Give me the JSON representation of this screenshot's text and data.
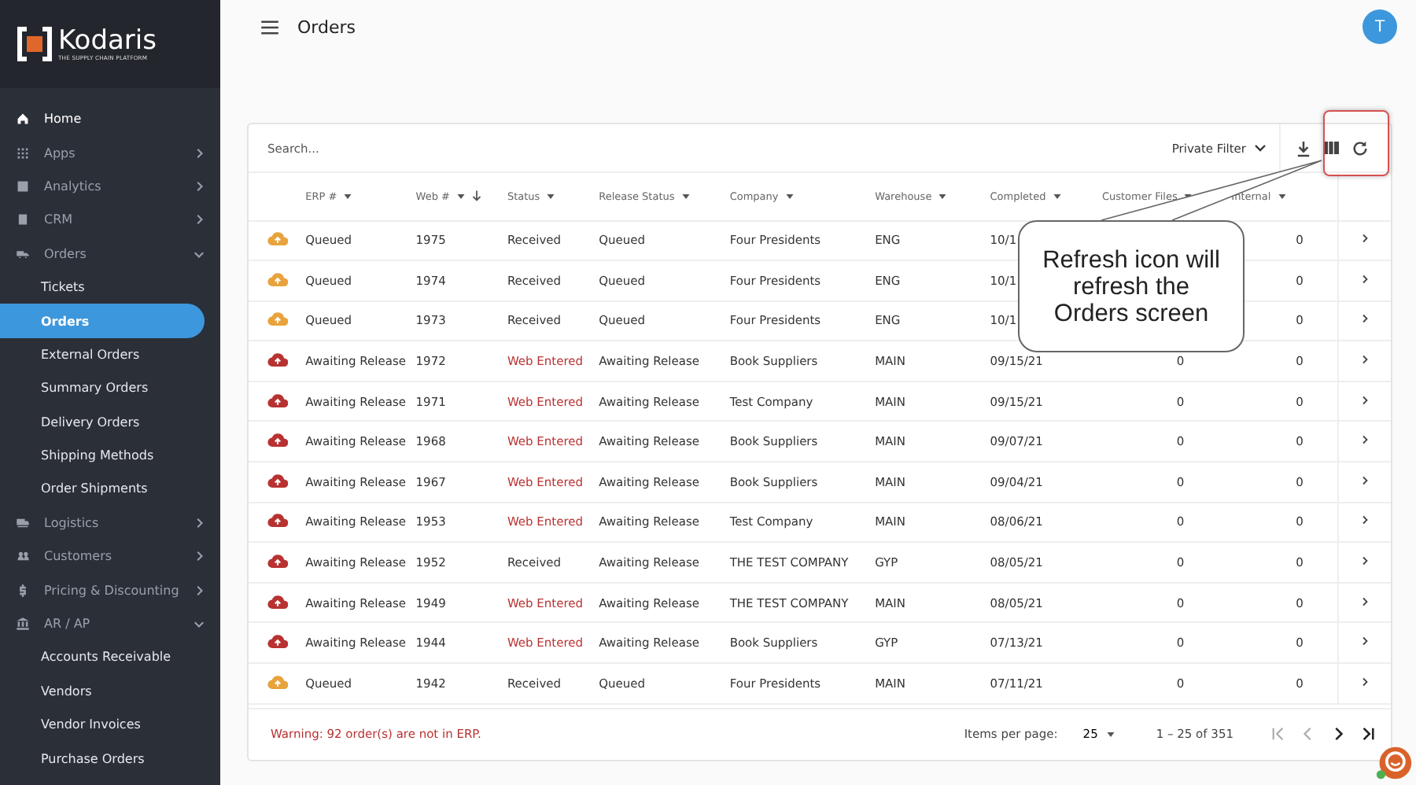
{
  "sidebar": {
    "logo": {
      "name": "Kodaris",
      "tagline": "THE SUPPLY CHAIN PLATFORM"
    },
    "items": [
      {
        "label": "Home"
      },
      {
        "label": "Apps",
        "expanded": false
      },
      {
        "label": "Analytics",
        "expanded": false
      },
      {
        "label": "CRM",
        "expanded": false
      },
      {
        "label": "Orders",
        "expanded": true,
        "children": [
          {
            "label": "Tickets",
            "selected": false
          },
          {
            "label": "Orders",
            "selected": true
          },
          {
            "label": "External Orders",
            "selected": false
          },
          {
            "label": "Summary Orders",
            "selected": false
          },
          {
            "label": "Delivery Orders",
            "selected": false
          },
          {
            "label": "Shipping Methods",
            "selected": false
          },
          {
            "label": "Order Shipments",
            "selected": false
          }
        ]
      },
      {
        "label": "Logistics",
        "expanded": false
      },
      {
        "label": "Customers",
        "expanded": false
      },
      {
        "label": "Pricing & Discounting",
        "expanded": false
      },
      {
        "label": "AR / AP",
        "expanded": true,
        "children": [
          {
            "label": "Accounts Receivable",
            "selected": false
          },
          {
            "label": "Vendors",
            "selected": false
          },
          {
            "label": "Vendor Invoices",
            "selected": false
          },
          {
            "label": "Purchase Orders",
            "selected": false
          }
        ]
      }
    ]
  },
  "header": {
    "title": "Orders",
    "avatar": "T"
  },
  "toolbar": {
    "search": {
      "placeholder": "Search..."
    },
    "filter": "Private Filter"
  },
  "table": {
    "columns": [
      {
        "label": "ERP #",
        "sorted": false
      },
      {
        "label": "Web #",
        "sorted": true
      },
      {
        "label": "Status",
        "sorted": false
      },
      {
        "label": "Release Status",
        "sorted": false
      },
      {
        "label": "Company",
        "sorted": false
      },
      {
        "label": "Warehouse",
        "sorted": false
      },
      {
        "label": "Completed",
        "sorted": false
      },
      {
        "label": "Customer Files",
        "sorted": false
      },
      {
        "label": "Internal",
        "sorted": false
      }
    ],
    "rows": [
      {
        "color": "#e8a33d",
        "erp": "Queued",
        "web": "1975",
        "status": "Received",
        "status_alert": false,
        "release": "Queued",
        "company": "Four Presidents",
        "warehouse": "ENG",
        "completed": "10/1",
        "internal_files": "0"
      },
      {
        "color": "#e8a33d",
        "erp": "Queued",
        "web": "1974",
        "status": "Received",
        "status_alert": false,
        "release": "Queued",
        "company": "Four Presidents",
        "warehouse": "ENG",
        "completed": "10/1",
        "internal_files": "0"
      },
      {
        "color": "#e8a33d",
        "erp": "Queued",
        "web": "1973",
        "status": "Received",
        "status_alert": false,
        "release": "Queued",
        "company": "Four Presidents",
        "warehouse": "ENG",
        "completed": "10/1",
        "internal_files": "0"
      },
      {
        "color": "#b83232",
        "erp": "Awaiting Release",
        "web": "1972",
        "status": "Web Entered",
        "status_alert": true,
        "release": "Awaiting Release",
        "company": "Book Suppliers",
        "warehouse": "MAIN",
        "completed": "09/15/21",
        "customer_files": "0",
        "internal_files": "0"
      },
      {
        "color": "#b83232",
        "erp": "Awaiting Release",
        "web": "1971",
        "status": "Web Entered",
        "status_alert": true,
        "release": "Awaiting Release",
        "company": "Test Company",
        "warehouse": "MAIN",
        "completed": "09/15/21",
        "customer_files": "0",
        "internal_files": "0"
      },
      {
        "color": "#b83232",
        "erp": "Awaiting Release",
        "web": "1968",
        "status": "Web Entered",
        "status_alert": true,
        "release": "Awaiting Release",
        "company": "Book Suppliers",
        "warehouse": "MAIN",
        "completed": "09/07/21",
        "customer_files": "0",
        "internal_files": "0"
      },
      {
        "color": "#b83232",
        "erp": "Awaiting Release",
        "web": "1967",
        "status": "Web Entered",
        "status_alert": true,
        "release": "Awaiting Release",
        "company": "Book Suppliers",
        "warehouse": "MAIN",
        "completed": "09/04/21",
        "customer_files": "0",
        "internal_files": "0"
      },
      {
        "color": "#b83232",
        "erp": "Awaiting Release",
        "web": "1953",
        "status": "Web Entered",
        "status_alert": true,
        "release": "Awaiting Release",
        "company": "Test Company",
        "warehouse": "MAIN",
        "completed": "08/06/21",
        "customer_files": "0",
        "internal_files": "0"
      },
      {
        "color": "#b83232",
        "erp": "Awaiting Release",
        "web": "1952",
        "status": "Received",
        "status_alert": false,
        "release": "Awaiting Release",
        "company": "THE TEST COMPANY",
        "warehouse": "GYP",
        "completed": "08/05/21",
        "customer_files": "0",
        "internal_files": "0"
      },
      {
        "color": "#b83232",
        "erp": "Awaiting Release",
        "web": "1949",
        "status": "Web Entered",
        "status_alert": true,
        "release": "Awaiting Release",
        "company": "THE TEST COMPANY",
        "warehouse": "MAIN",
        "completed": "08/05/21",
        "customer_files": "0",
        "internal_files": "0"
      },
      {
        "color": "#b83232",
        "erp": "Awaiting Release",
        "web": "1944",
        "status": "Web Entered",
        "status_alert": true,
        "release": "Awaiting Release",
        "company": "Book Suppliers",
        "warehouse": "GYP",
        "completed": "07/13/21",
        "customer_files": "0",
        "internal_files": "0"
      },
      {
        "color": "#e8a33d",
        "erp": "Queued",
        "web": "1942",
        "status": "Received",
        "status_alert": false,
        "release": "Queued",
        "company": "Four Presidents",
        "warehouse": "MAIN",
        "completed": "07/11/21",
        "customer_files": "0",
        "internal_files": "0"
      }
    ]
  },
  "footer": {
    "warning": "Warning: 92 order(s) are not in ERP.",
    "items_per_page_label": "Items per page:",
    "page_size": "25",
    "range": "1 – 25 of 351"
  },
  "callout": {
    "text": "Refresh icon will refresh the Orders screen"
  }
}
